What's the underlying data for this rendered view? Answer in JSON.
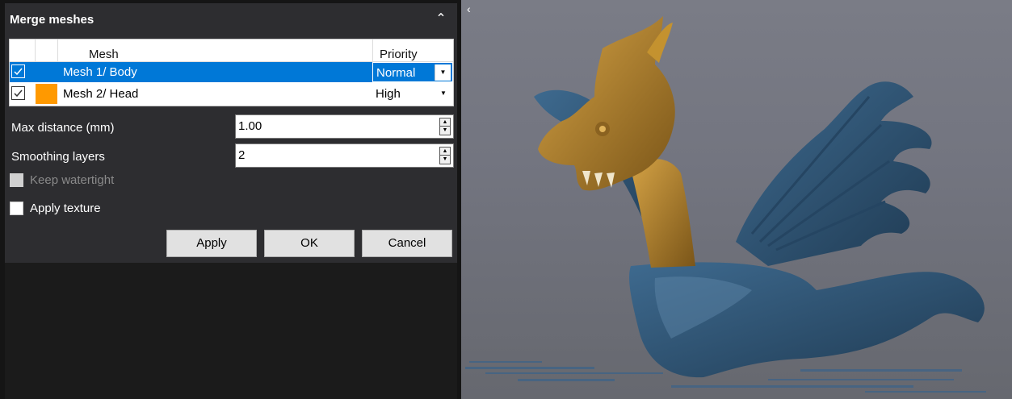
{
  "panel": {
    "title": "Merge meshes",
    "collapse_icon": "chevron-up-icon"
  },
  "table": {
    "columns": [
      "Mesh",
      "Priority"
    ],
    "rows": [
      {
        "checked": true,
        "color": "#0078d7",
        "name": "Mesh 1/ Body",
        "priority": "Normal",
        "selected": true
      },
      {
        "checked": true,
        "color": "#ff9900",
        "name": "Mesh 2/ Head",
        "priority": "High",
        "selected": false
      }
    ]
  },
  "fields": {
    "max_distance": {
      "label": "Max distance (mm)",
      "value": "1.00"
    },
    "smoothing_layers": {
      "label": "Smoothing layers",
      "value": "2"
    }
  },
  "options": {
    "keep_watertight": {
      "label": "Keep watertight",
      "checked": false,
      "disabled": true
    },
    "apply_texture": {
      "label": "Apply texture",
      "checked": false
    }
  },
  "buttons": {
    "apply": "Apply",
    "ok": "OK",
    "cancel": "Cancel"
  },
  "viewport": {
    "collapse_icon": "chevron-left-icon",
    "mesh_colors": {
      "body": "#2f5170",
      "head": "#b8862c"
    }
  }
}
